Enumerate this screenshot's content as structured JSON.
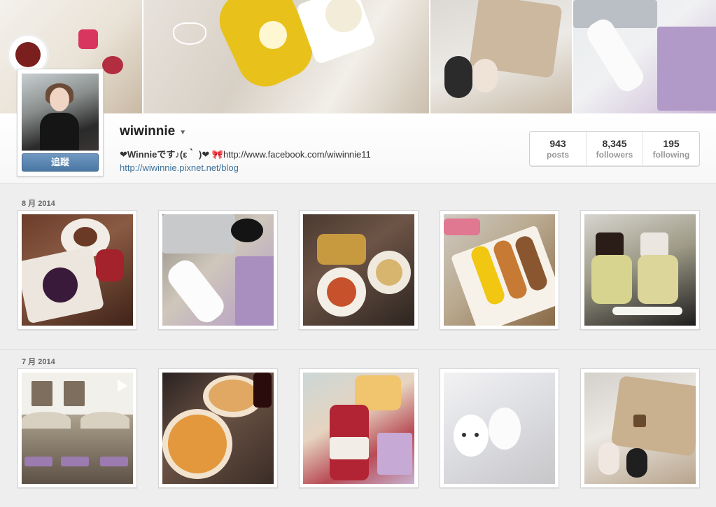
{
  "profile": {
    "username": "wiwinnie",
    "follow_label": "追蹤",
    "bio_part1": "❤Winnieです♪(ε｀ )❤",
    "bio_part2": "http://www.facebook.com/wiwinnie11",
    "website": "http://wiwinnie.pixnet.net/blog"
  },
  "stats": [
    {
      "value": "943",
      "label": "posts"
    },
    {
      "value": "8,345",
      "label": "followers"
    },
    {
      "value": "195",
      "label": "following"
    }
  ],
  "sections": [
    {
      "month": "8 月 2014"
    },
    {
      "month": "7 月 2014"
    }
  ],
  "icons": {
    "dropdown": "chevron-down-icon",
    "ribbon": "ribbon-icon",
    "video": "video-icon"
  }
}
